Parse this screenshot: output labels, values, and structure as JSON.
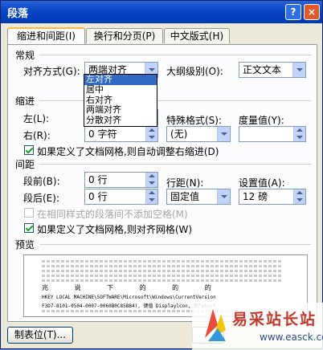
{
  "window": {
    "title": "段落",
    "help_label": "?",
    "close_label": "×"
  },
  "tabs": [
    {
      "label": "缩进和间距(I)"
    },
    {
      "label": "换行和分页(P)"
    },
    {
      "label": "中文版式(H)"
    }
  ],
  "general": {
    "section_label": "常规",
    "alignment_label": "对齐方式(G):",
    "alignment_value": "两端对齐",
    "alignment_options": [
      "左对齐",
      "居中",
      "右对齐",
      "两端对齐",
      "分散对齐"
    ],
    "alignment_selected_index": 0,
    "outline_label": "大纲级别(O):",
    "outline_value": "正文文本"
  },
  "indent": {
    "section_label": "缩进",
    "left_label": "左(L):",
    "right_label": "右(R):",
    "right_value": "0 字符",
    "special_label": "特殊格式(S):",
    "special_value": "(无)",
    "measure_label": "度量值(Y):",
    "grid_check_label": "如果定义了文档网格,则自动调整右缩进(D)"
  },
  "spacing": {
    "section_label": "间距",
    "before_label": "段前(B):",
    "before_value": "0 行",
    "after_label": "段后(E):",
    "after_value": "0 行",
    "line_label": "行距(N):",
    "line_value": "固定值",
    "at_label": "设置值(A):",
    "at_value": "12 磅",
    "no_space_label": "在相同样式的段落间不添加空格(M)",
    "snap_label": "如果定义了文档网格,则对齐网格(W)"
  },
  "preview": {
    "section_label": "预览",
    "sample_chars": "兆  说  下  的  的  的",
    "sample_line1": "HKEY LOCAL MACHINE\\SOFTWARE\\Microsoft\\Windows\\CurrentVersion",
    "sample_line2": "F3D7-8101-0504-0007-0060B0C85BB4), 键值 Displaylcon, 把\"shuxF"
  },
  "buttons": {
    "tabs_label": "制表位(T)..."
  },
  "watermark": {
    "text": "易采站长站",
    "url": "www.easck.com"
  }
}
